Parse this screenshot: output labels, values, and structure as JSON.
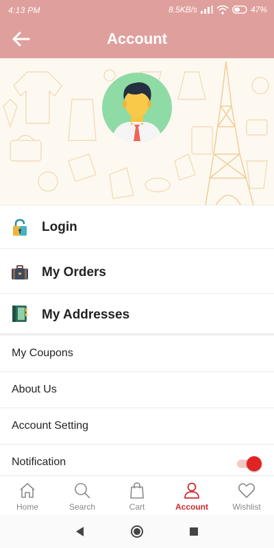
{
  "status_bar": {
    "time": "4:13 PM",
    "speed": "8.5KB/s",
    "battery": "47%",
    "icons": [
      "signal-icon",
      "wifi-icon",
      "battery-icon"
    ]
  },
  "header": {
    "title": "Account",
    "back_icon": "arrow-left-icon"
  },
  "colors": {
    "header_bg": "#dfa09d",
    "accent_active": "#d0262c",
    "toggle_on": "#e22323"
  },
  "profile": {
    "avatar_icon": "user-avatar-icon"
  },
  "primary_menu": [
    {
      "label": "Login",
      "icon": "lock-icon"
    },
    {
      "label": "My Orders",
      "icon": "briefcase-icon"
    },
    {
      "label": "My Addresses",
      "icon": "address-book-icon"
    }
  ],
  "secondary_menu": [
    {
      "label": "My Coupons"
    },
    {
      "label": "About Us"
    },
    {
      "label": "Account Setting"
    },
    {
      "label": "Notification",
      "toggle_on": true
    }
  ],
  "bottom_nav": [
    {
      "label": "Home",
      "icon": "home-icon",
      "active": false
    },
    {
      "label": "Search",
      "icon": "search-icon",
      "active": false
    },
    {
      "label": "Cart",
      "icon": "bag-icon",
      "active": false
    },
    {
      "label": "Account",
      "icon": "user-icon",
      "active": true
    },
    {
      "label": "Wishlist",
      "icon": "heart-icon",
      "active": false
    }
  ],
  "system_nav": [
    "back-triangle-icon",
    "home-circle-icon",
    "recents-square-icon"
  ]
}
